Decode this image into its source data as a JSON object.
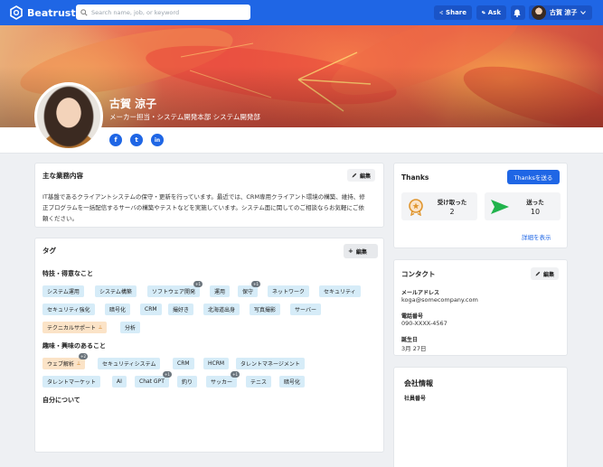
{
  "header": {
    "brand": "Beatrust",
    "search_placeholder": "Search name, job, or keyword",
    "share_label": "Share",
    "ask_label": "Ask",
    "user_name": "古賀 涼子"
  },
  "profile": {
    "name": "古賀 涼子",
    "department": "メーカー担当・システム開発本部 システム開発部",
    "social": [
      "f",
      "t",
      "in"
    ]
  },
  "business": {
    "title": "主な業務内容",
    "edit_label": "編集",
    "description": "IT基盤であるクライアントシステムの保守・更新を行っています。最近では、CRM専用クライアント環境の構築、維持、修正プログラムを一括配信するサーバの構築やテストなどを実施しています。システム面に関してのご相談ならお気軽にご依頼ください。"
  },
  "tags": {
    "title": "タグ",
    "edit_label": "編集",
    "skills_heading": "特技・得意なこと",
    "skills": [
      "システム運用",
      "システム構築",
      "ソフトウェア開発",
      "運用",
      "保守",
      "ネットワーク",
      "セキュリティ",
      "セキュリティ強化",
      "暗号化",
      "CRM",
      "撮好き",
      "北海道出身",
      "写真撮影",
      "サーバー",
      "テクニカルサポート",
      "分析"
    ],
    "skill_badges": {
      "2": "+1",
      "4": "+1"
    },
    "interests_heading": "趣味・興味のあること",
    "interests": [
      "ウェブ解析",
      "セキュリティシステム",
      "CRM",
      "HCRM",
      "タレントマネージメント",
      "タレントマーケット",
      "AI",
      "Chat GPT",
      "釣り",
      "サッカー",
      "テニス",
      "暗号化"
    ],
    "interest_badges": {
      "0": "+2",
      "7": "+1",
      "9": "+1"
    },
    "about_heading": "自分について"
  },
  "thanks": {
    "title": "Thanks",
    "send_button": "Thanksを送る",
    "received_label": "受け取った",
    "received_count": "2",
    "sent_label": "送った",
    "sent_count": "10",
    "details_link": "詳細を表示"
  },
  "contact": {
    "title": "コンタクト",
    "edit_label": "編集",
    "email_label": "メールアドレス",
    "email": "koga@somecompany.com",
    "phone_label": "電話番号",
    "phone": "090-XXXX-4567",
    "birthday_label": "誕生日",
    "birthday": "3月 27日"
  },
  "company": {
    "title": "会社情報",
    "employee_id_label": "社員番号"
  }
}
